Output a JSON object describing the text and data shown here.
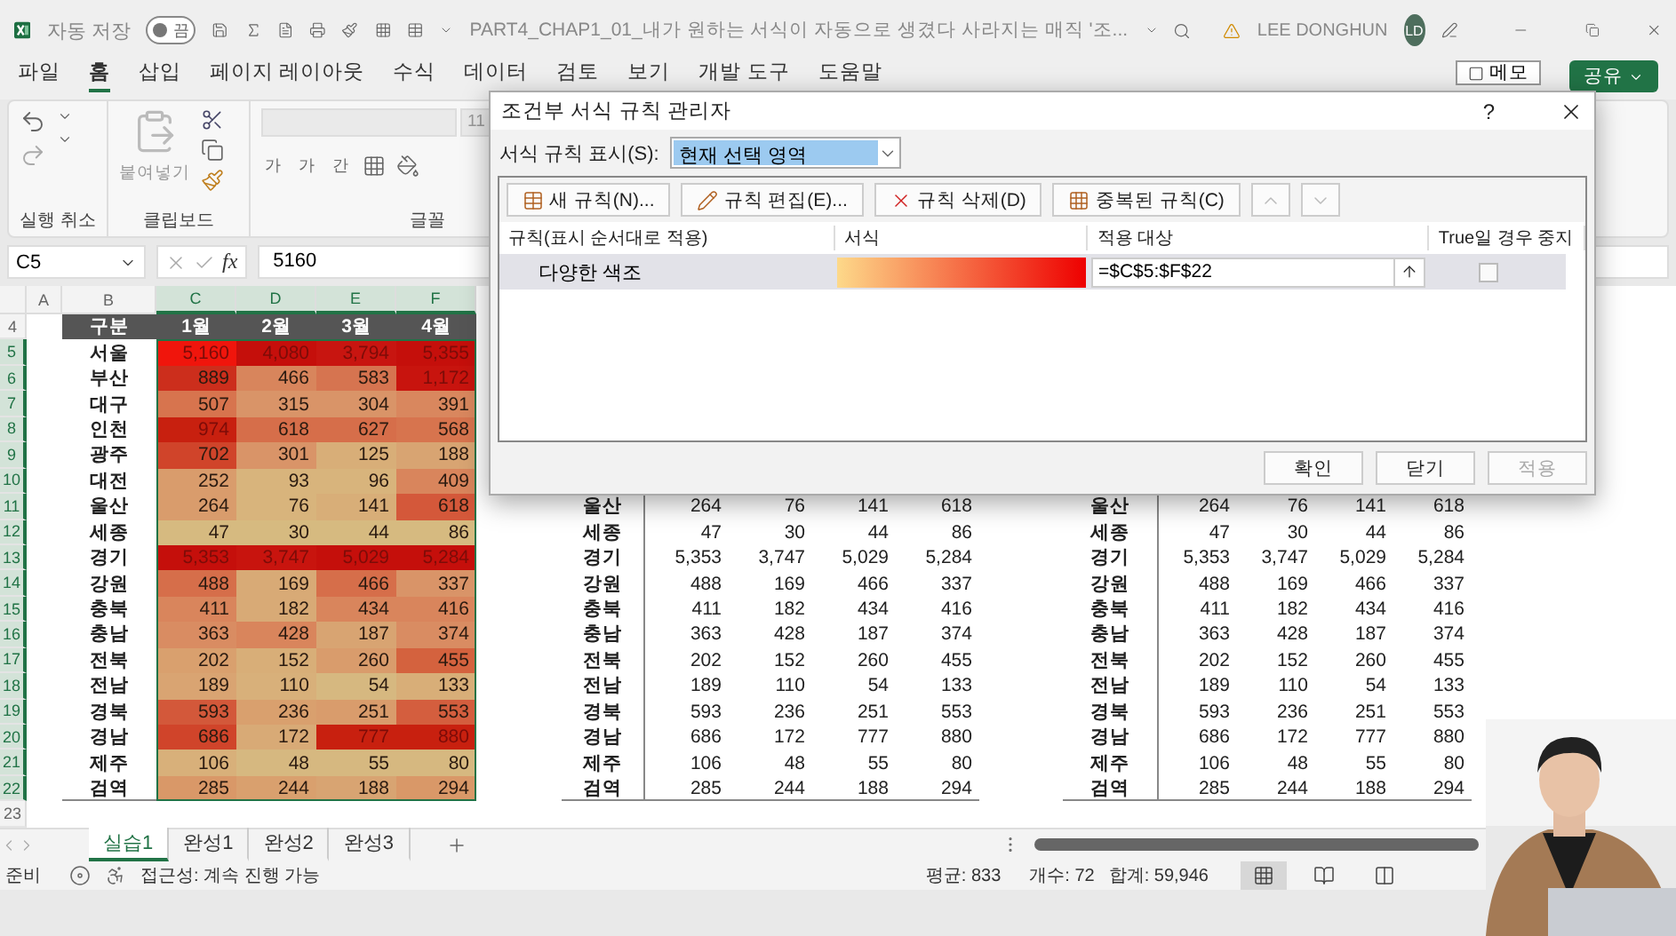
{
  "title_bar": {
    "autosave_label": "자동 저장",
    "autosave": {
      "label": "끔",
      "on": false
    },
    "document_title": "PART4_CHAP1_01_내가 원하는 서식이 자동으로 생겼다 사라지는 매직 '조...",
    "user_name": "LEE DONGHUN",
    "avatar_initials": "LD"
  },
  "menu_tabs": [
    {
      "label": "파일",
      "selected": false
    },
    {
      "label": "홈",
      "selected": true
    },
    {
      "label": "삽입",
      "selected": false
    },
    {
      "label": "페이지 레이아웃",
      "selected": false
    },
    {
      "label": "수식",
      "selected": false
    },
    {
      "label": "데이터",
      "selected": false
    },
    {
      "label": "검토",
      "selected": false
    },
    {
      "label": "보기",
      "selected": false
    },
    {
      "label": "개발 도구",
      "selected": false
    },
    {
      "label": "도움말",
      "selected": false
    }
  ],
  "memo_button": "메모",
  "share_button": "공유",
  "ribbon": {
    "undo_group": "실행 취소",
    "clipboard_group": "클립보드",
    "paste_label": "붙여넣기",
    "font_group": "글꼴",
    "font_size": "11",
    "font_buttons": [
      "가",
      "가",
      "간"
    ]
  },
  "formula_bar": {
    "name_box": "C5",
    "function_button": "fx",
    "formula": "5160"
  },
  "sheet": {
    "column_headers": [
      {
        "label": "A",
        "selected": false
      },
      {
        "label": "B",
        "selected": false
      },
      {
        "label": "C",
        "selected": true
      },
      {
        "label": "D",
        "selected": true
      },
      {
        "label": "E",
        "selected": true
      },
      {
        "label": "F",
        "selected": true
      }
    ],
    "row_numbers": [
      {
        "label": "4",
        "selected": false
      },
      {
        "label": "5",
        "selected": true
      },
      {
        "label": "6",
        "selected": true
      },
      {
        "label": "7",
        "selected": true
      },
      {
        "label": "8",
        "selected": true
      },
      {
        "label": "9",
        "selected": true
      },
      {
        "label": "10",
        "selected": true
      },
      {
        "label": "11",
        "selected": true
      },
      {
        "label": "12",
        "selected": true
      },
      {
        "label": "13",
        "selected": true
      },
      {
        "label": "14",
        "selected": true
      },
      {
        "label": "15",
        "selected": true
      },
      {
        "label": "16",
        "selected": true
      },
      {
        "label": "17",
        "selected": true
      },
      {
        "label": "18",
        "selected": true
      },
      {
        "label": "19",
        "selected": true
      },
      {
        "label": "20",
        "selected": true
      },
      {
        "label": "21",
        "selected": true
      },
      {
        "label": "22",
        "selected": true
      },
      {
        "label": "23",
        "selected": false
      }
    ],
    "table": {
      "headers": [
        "구분",
        "1월",
        "2월",
        "3월",
        "4월"
      ],
      "rows": [
        {
          "region": "서울",
          "cells": [
            {
              "value": "5,160",
              "color": "#f0150c"
            },
            {
              "value": "4,080",
              "color": "#c50f0b"
            },
            {
              "value": "3,794",
              "color": "#c81510"
            },
            {
              "value": "5,355",
              "color": "#c50f0b"
            }
          ]
        },
        {
          "region": "부산",
          "cells": [
            {
              "value": "889",
              "color": "#cc2e1c"
            },
            {
              "value": "466",
              "color": "#d8855c"
            },
            {
              "value": "583",
              "color": "#d67450"
            },
            {
              "value": "1,172",
              "color": "#c8140e"
            }
          ]
        },
        {
          "region": "대구",
          "cells": [
            {
              "value": "507",
              "color": "#d7744e"
            },
            {
              "value": "315",
              "color": "#d99468"
            },
            {
              "value": "304",
              "color": "#d99468"
            },
            {
              "value": "391",
              "color": "#d9875e"
            }
          ]
        },
        {
          "region": "인천",
          "cells": [
            {
              "value": "974",
              "color": "#c8200f"
            },
            {
              "value": "618",
              "color": "#d66e4a"
            },
            {
              "value": "627",
              "color": "#d66e4a"
            },
            {
              "value": "568",
              "color": "#d7744e"
            }
          ]
        },
        {
          "region": "광주",
          "cells": [
            {
              "value": "702",
              "color": "#d0442a"
            },
            {
              "value": "301",
              "color": "#d99468"
            },
            {
              "value": "125",
              "color": "#d8ae78"
            },
            {
              "value": "188",
              "color": "#d8a472"
            }
          ]
        },
        {
          "region": "대전",
          "cells": [
            {
              "value": "252",
              "color": "#d99c6c"
            },
            {
              "value": "93",
              "color": "#d8b47c"
            },
            {
              "value": "96",
              "color": "#d8b47c"
            },
            {
              "value": "409",
              "color": "#d9855c"
            }
          ]
        },
        {
          "region": "울산",
          "cells": [
            {
              "value": "264",
              "color": "#d99c6c"
            },
            {
              "value": "76",
              "color": "#d8b47c"
            },
            {
              "value": "141",
              "color": "#d8ae78"
            },
            {
              "value": "618",
              "color": "#d4583a"
            }
          ]
        },
        {
          "region": "세종",
          "cells": [
            {
              "value": "47",
              "color": "#d6ba80"
            },
            {
              "value": "30",
              "color": "#d6ba80"
            },
            {
              "value": "44",
              "color": "#d6ba80"
            },
            {
              "value": "86",
              "color": "#d6ba80"
            }
          ]
        },
        {
          "region": "경기",
          "cells": [
            {
              "value": "5,353",
              "color": "#c50f0b"
            },
            {
              "value": "3,747",
              "color": "#c8140e"
            },
            {
              "value": "5,029",
              "color": "#c50f0b"
            },
            {
              "value": "5,284",
              "color": "#c50f0b"
            }
          ]
        },
        {
          "region": "강원",
          "cells": [
            {
              "value": "488",
              "color": "#d66e4a"
            },
            {
              "value": "169",
              "color": "#d8aa76"
            },
            {
              "value": "466",
              "color": "#d66e4a"
            },
            {
              "value": "337",
              "color": "#d99468"
            }
          ]
        },
        {
          "region": "충북",
          "cells": [
            {
              "value": "411",
              "color": "#d9855c"
            },
            {
              "value": "182",
              "color": "#d8aa76"
            },
            {
              "value": "434",
              "color": "#d9855c"
            },
            {
              "value": "416",
              "color": "#d9855c"
            }
          ]
        },
        {
          "region": "충남",
          "cells": [
            {
              "value": "363",
              "color": "#d98c62"
            },
            {
              "value": "428",
              "color": "#d9855c"
            },
            {
              "value": "187",
              "color": "#d8a472"
            },
            {
              "value": "374",
              "color": "#d98c62"
            }
          ]
        },
        {
          "region": "전북",
          "cells": [
            {
              "value": "202",
              "color": "#d9a06e"
            },
            {
              "value": "152",
              "color": "#d8ae78"
            },
            {
              "value": "260",
              "color": "#d99c6c"
            },
            {
              "value": "455",
              "color": "#d4623e"
            }
          ]
        },
        {
          "region": "전남",
          "cells": [
            {
              "value": "189",
              "color": "#d9a472"
            },
            {
              "value": "110",
              "color": "#d8b07a"
            },
            {
              "value": "54",
              "color": "#d6b880"
            },
            {
              "value": "133",
              "color": "#d8ae78"
            }
          ]
        },
        {
          "region": "경북",
          "cells": [
            {
              "value": "593",
              "color": "#d3583a"
            },
            {
              "value": "236",
              "color": "#d9a06e"
            },
            {
              "value": "251",
              "color": "#d99c6c"
            },
            {
              "value": "553",
              "color": "#d45e3e"
            }
          ]
        },
        {
          "region": "경남",
          "cells": [
            {
              "value": "686",
              "color": "#d0442a"
            },
            {
              "value": "172",
              "color": "#d8aa76"
            },
            {
              "value": "777",
              "color": "#c8200f"
            },
            {
              "value": "880",
              "color": "#c8200f"
            }
          ]
        },
        {
          "region": "제주",
          "cells": [
            {
              "value": "106",
              "color": "#d8b07a"
            },
            {
              "value": "48",
              "color": "#d6b880"
            },
            {
              "value": "55",
              "color": "#d6b880"
            },
            {
              "value": "80",
              "color": "#d6b880"
            }
          ]
        },
        {
          "region": "검역",
          "cells": [
            {
              "value": "285",
              "color": "#d99868"
            },
            {
              "value": "244",
              "color": "#d9a06e"
            },
            {
              "value": "188",
              "color": "#d8a472"
            },
            {
              "value": "294",
              "color": "#d99868"
            }
          ]
        }
      ]
    },
    "table_2": {
      "rows": [
        {
          "region": "울산",
          "values": [
            "264",
            "76",
            "141",
            "618"
          ]
        },
        {
          "region": "세종",
          "values": [
            "47",
            "30",
            "44",
            "86"
          ]
        },
        {
          "region": "경기",
          "values": [
            "5,353",
            "3,747",
            "5,029",
            "5,284"
          ]
        },
        {
          "region": "강원",
          "values": [
            "488",
            "169",
            "466",
            "337"
          ]
        },
        {
          "region": "충북",
          "values": [
            "411",
            "182",
            "434",
            "416"
          ]
        },
        {
          "region": "충남",
          "values": [
            "363",
            "428",
            "187",
            "374"
          ]
        },
        {
          "region": "전북",
          "values": [
            "202",
            "152",
            "260",
            "455"
          ]
        },
        {
          "region": "전남",
          "values": [
            "189",
            "110",
            "54",
            "133"
          ]
        },
        {
          "region": "경북",
          "values": [
            "593",
            "236",
            "251",
            "553"
          ]
        },
        {
          "region": "경남",
          "values": [
            "686",
            "172",
            "777",
            "880"
          ]
        },
        {
          "region": "제주",
          "values": [
            "106",
            "48",
            "55",
            "80"
          ]
        },
        {
          "region": "검역",
          "values": [
            "285",
            "244",
            "188",
            "294"
          ]
        }
      ]
    },
    "table_3": {
      "rows": [
        {
          "region": "울산",
          "values": [
            "264",
            "76",
            "141",
            "618"
          ]
        },
        {
          "region": "세종",
          "values": [
            "47",
            "30",
            "44",
            "86"
          ]
        },
        {
          "region": "경기",
          "values": [
            "5,353",
            "3,747",
            "5,029",
            "5,284"
          ]
        },
        {
          "region": "강원",
          "values": [
            "488",
            "169",
            "466",
            "337"
          ]
        },
        {
          "region": "충북",
          "values": [
            "411",
            "182",
            "434",
            "416"
          ]
        },
        {
          "region": "충남",
          "values": [
            "363",
            "428",
            "187",
            "374"
          ]
        },
        {
          "region": "전북",
          "values": [
            "202",
            "152",
            "260",
            "455"
          ]
        },
        {
          "region": "전남",
          "values": [
            "189",
            "110",
            "54",
            "133"
          ]
        },
        {
          "region": "경북",
          "values": [
            "593",
            "236",
            "251",
            "553"
          ]
        },
        {
          "region": "경남",
          "values": [
            "686",
            "172",
            "777",
            "880"
          ]
        },
        {
          "region": "제주",
          "values": [
            "106",
            "48",
            "55",
            "80"
          ]
        },
        {
          "region": "검역",
          "values": [
            "285",
            "244",
            "188",
            "294"
          ]
        }
      ]
    }
  },
  "sheet_tabs": [
    {
      "label": "실습1",
      "selected": true
    },
    {
      "label": "완성1",
      "selected": false
    },
    {
      "label": "완성2",
      "selected": false
    },
    {
      "label": "완성3",
      "selected": false
    }
  ],
  "status_bar": {
    "mode": "준비",
    "accessibility": "접근성: 계속 진행 가능",
    "average": "평균: 833",
    "count": "개수: 72",
    "sum": "합계: 59,946",
    "views": [
      {
        "kind": "normal",
        "selected": true
      },
      {
        "kind": "page_layout",
        "selected": false
      },
      {
        "kind": "page_break",
        "selected": false
      }
    ]
  },
  "dialog": {
    "title": "조건부 서식 규칙 관리자",
    "help": "?",
    "show_rules_label": "서식 규칙 표시(S):",
    "show_rules_value": "현재 선택 영역",
    "toolbar": [
      {
        "kind": "new",
        "label": "새 규칙(N)..."
      },
      {
        "kind": "edit",
        "label": "규칙 편집(E)..."
      },
      {
        "kind": "delete",
        "label": "규칙 삭제(D)"
      },
      {
        "kind": "duplicate",
        "label": "중복된 규칙(C)"
      },
      {
        "kind": "up"
      },
      {
        "kind": "down"
      }
    ],
    "columns": [
      "규칙(표시 순서대로 적용)",
      "서식",
      "적용 대상",
      "True일 경우 중지"
    ],
    "rules": [
      {
        "name": "다양한 색조",
        "kind": "color_scale",
        "applies_to": "=$C$5:$F$22",
        "stop_if_true": false,
        "selected": true
      }
    ],
    "buttons": [
      {
        "label": "확인",
        "disabled": false
      },
      {
        "label": "닫기",
        "disabled": false
      },
      {
        "label": "적용",
        "disabled": true
      }
    ]
  }
}
